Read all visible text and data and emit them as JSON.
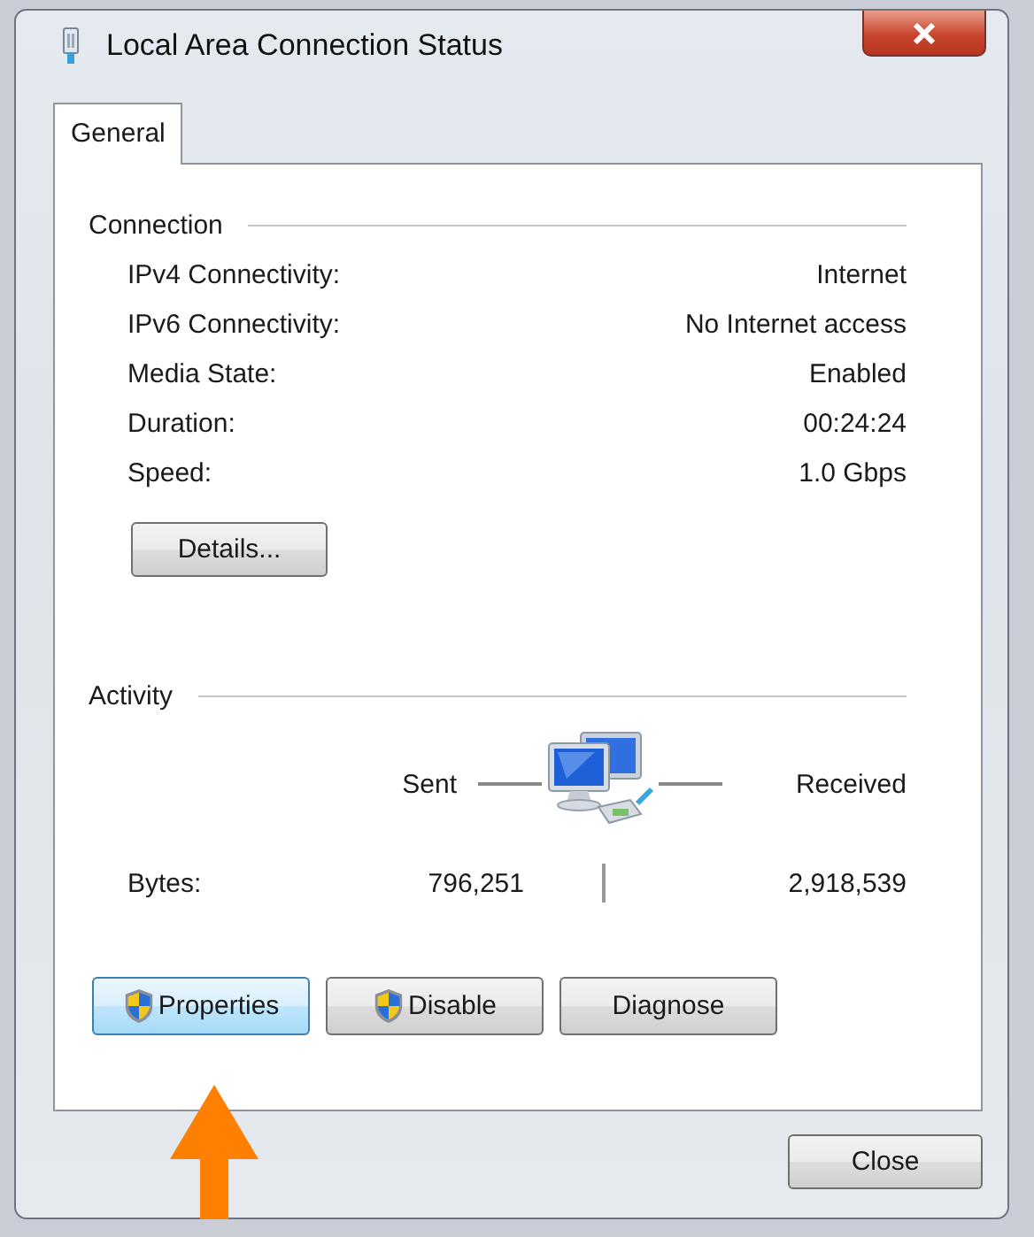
{
  "window": {
    "title": "Local Area Connection Status"
  },
  "tabs": [
    {
      "label": "General",
      "selected": true
    }
  ],
  "connection": {
    "heading": "Connection",
    "rows": [
      {
        "label": "IPv4 Connectivity:",
        "value": "Internet"
      },
      {
        "label": "IPv6 Connectivity:",
        "value": "No Internet access"
      },
      {
        "label": "Media State:",
        "value": "Enabled"
      },
      {
        "label": "Duration:",
        "value": "00:24:24"
      },
      {
        "label": "Speed:",
        "value": "1.0 Gbps"
      }
    ],
    "details_button": "Details..."
  },
  "activity": {
    "heading": "Activity",
    "sent_label": "Sent",
    "received_label": "Received",
    "bytes_label": "Bytes:",
    "bytes_sent": "796,251",
    "bytes_received": "2,918,539"
  },
  "actions": [
    {
      "label": "Properties",
      "kind": "shield",
      "highlighted": true
    },
    {
      "label": "Disable",
      "kind": "shield",
      "highlighted": false
    },
    {
      "label": "Diagnose",
      "kind": "plain",
      "highlighted": false
    }
  ],
  "close_button": "Close"
}
